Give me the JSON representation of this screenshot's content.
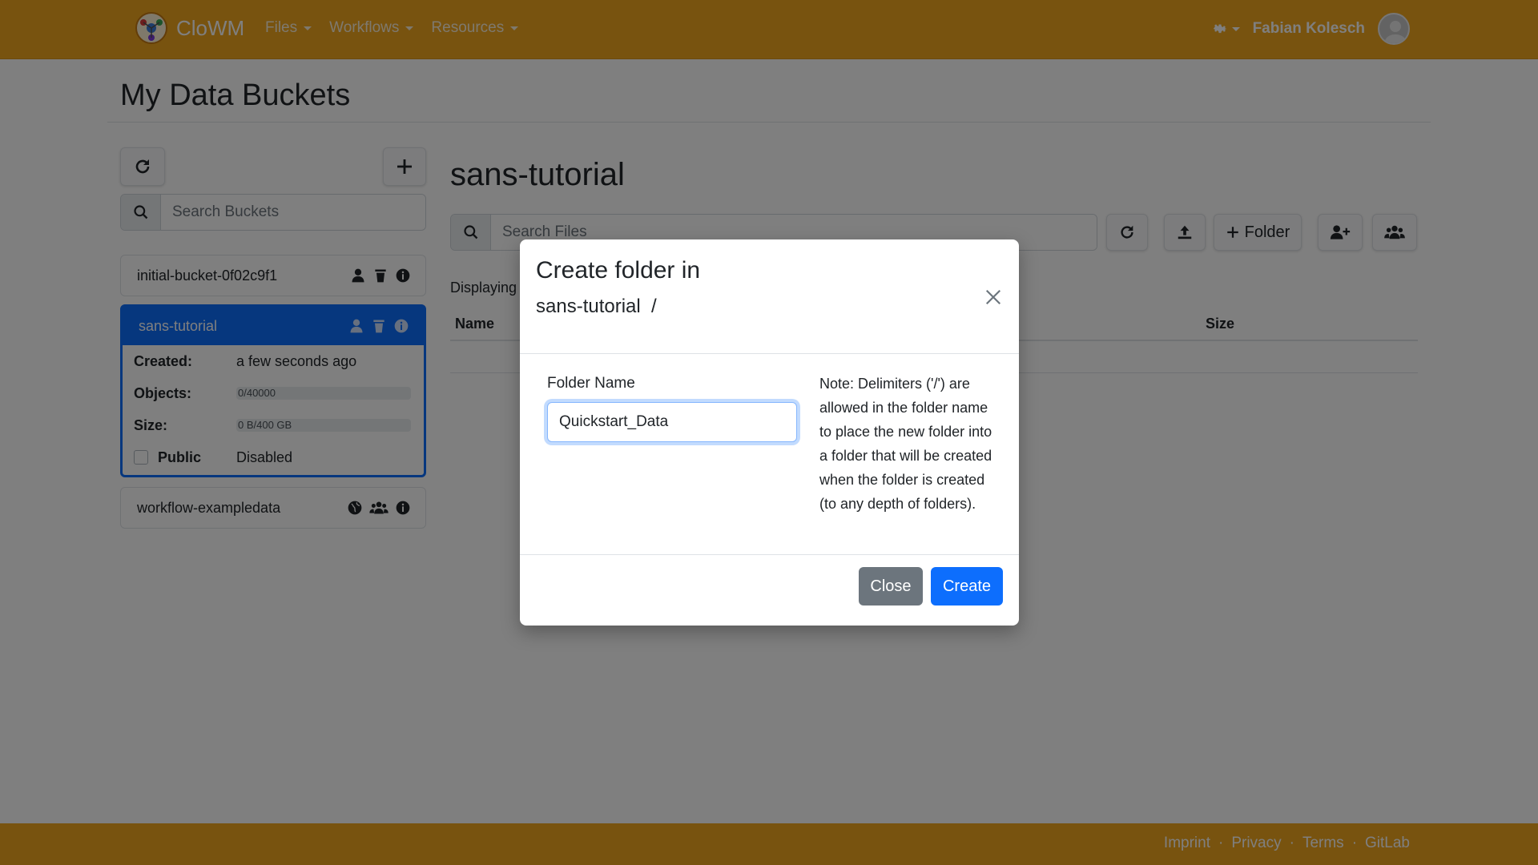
{
  "app": {
    "name": "CloWM",
    "brand_color": "#f0a61e",
    "accent_color": "#0d6efd"
  },
  "navbar": {
    "menus": [
      {
        "label": "Files"
      },
      {
        "label": "Workflows"
      },
      {
        "label": "Resources"
      }
    ],
    "theme_icon": "gear-icon",
    "user_name": "Fabian Kolesch"
  },
  "page": {
    "title": "My Data Buckets"
  },
  "sidebar": {
    "search_placeholder": "Search Buckets",
    "buckets": [
      {
        "name": "initial-bucket-0f02c9f1",
        "icons": [
          "user-icon",
          "trash-icon",
          "info-icon"
        ]
      },
      {
        "name": "sans-tutorial",
        "icons": [
          "user-icon",
          "trash-icon",
          "info-icon"
        ],
        "active": true,
        "details": {
          "created_label": "Created:",
          "created_value": "a few seconds ago",
          "objects_label": "Objects:",
          "objects_value": "0/40000",
          "objects_fraction": 0,
          "size_label": "Size:",
          "size_value": "0 B/400 GB",
          "size_fraction": 0,
          "public_label": "Public",
          "public_value": "Disabled"
        }
      },
      {
        "name": "workflow-exampledata",
        "icons": [
          "globe-icon",
          "users-icon",
          "info-icon"
        ]
      }
    ]
  },
  "main": {
    "bucket_title": "sans-tutorial",
    "search_placeholder": "Search Files",
    "folder_button_label": "Folder",
    "displaying_text": "Displaying",
    "table": {
      "columns": [
        "Name",
        "Size"
      ]
    }
  },
  "modal": {
    "title": "Create folder in",
    "path": "sans-tutorial  /",
    "field_label": "Folder Name",
    "field_value": "Quickstart_Data",
    "note": "Note: Delimiters ('/') are allowed in the folder name to place the new folder into a folder that will be created when the folder is created (to any depth of folders).",
    "close_label": "Close",
    "create_label": "Create"
  },
  "footer": {
    "links": [
      "Imprint",
      "Privacy",
      "Terms",
      "GitLab"
    ]
  }
}
